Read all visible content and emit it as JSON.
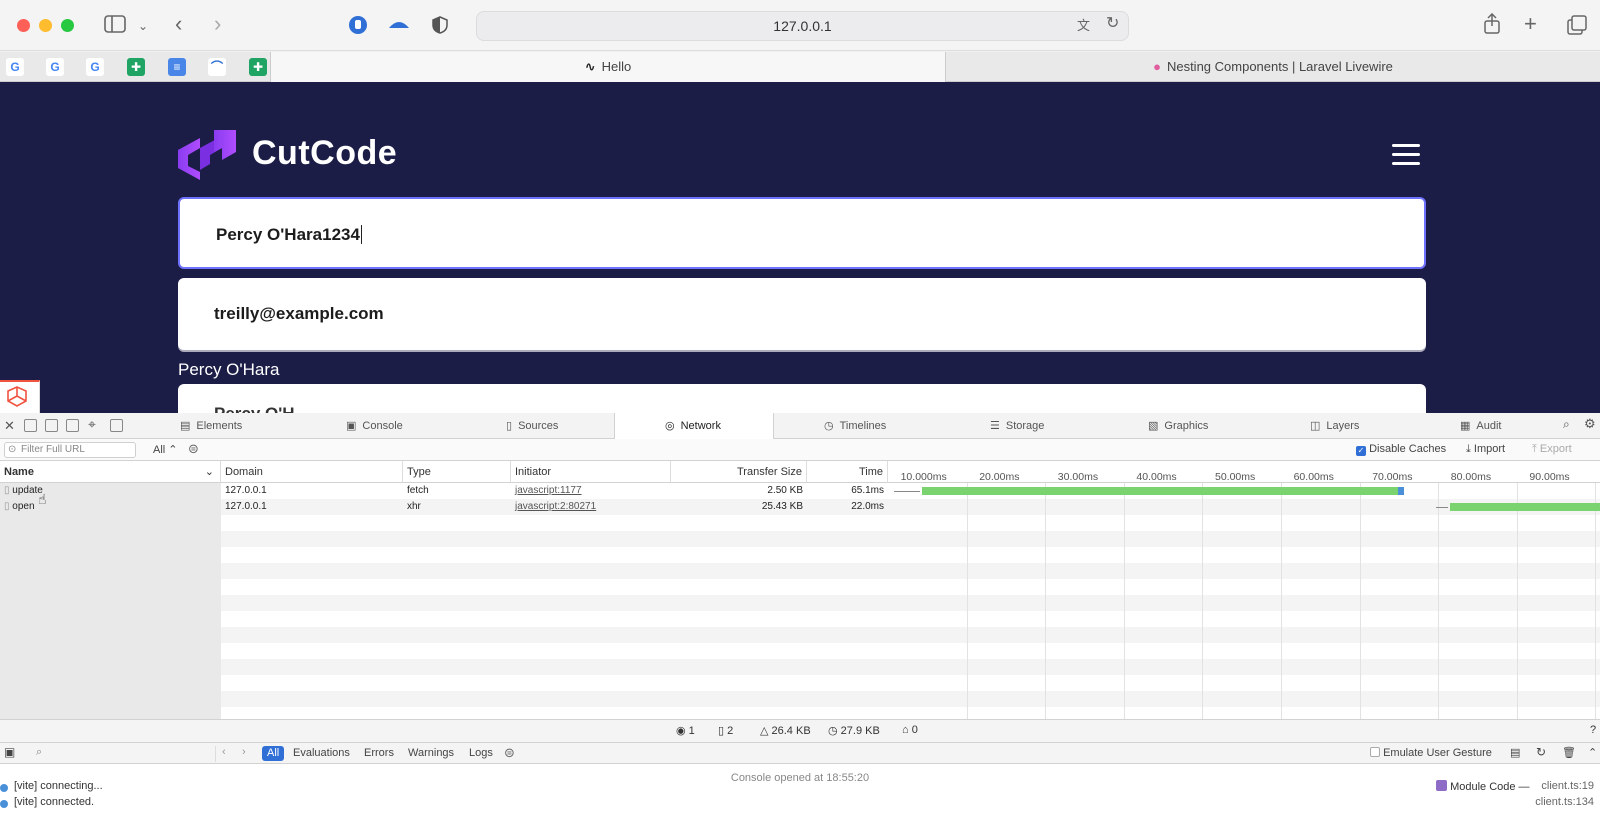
{
  "browser": {
    "url": "127.0.0.1",
    "tabs": [
      {
        "label": "Hello",
        "active": true
      },
      {
        "label": "Nesting Components | Laravel Livewire",
        "active": false
      }
    ],
    "bookmark_icons": [
      "google-icon",
      "google-icon",
      "google-icon",
      "sheets-icon",
      "docs-icon",
      "app-icon",
      "sheets-icon"
    ]
  },
  "page": {
    "brand": "CutCode",
    "name_input_value": "Percy O'Hara1234",
    "email_input_value": "treilly@example.com",
    "name_label": "Percy O'Hara",
    "third_field_value": "Percy O'H"
  },
  "devtools": {
    "tabs": [
      "Elements",
      "Console",
      "Sources",
      "Network",
      "Timelines",
      "Storage",
      "Graphics",
      "Layers",
      "Audit"
    ],
    "active_tab": "Network",
    "filter_placeholder": "Filter Full URL",
    "type_filter": "All",
    "disable_caches_label": "Disable Caches",
    "import_label": "Import",
    "export_label": "Export",
    "columns": [
      "Name",
      "Domain",
      "Type",
      "Initiator",
      "Transfer Size",
      "Time"
    ],
    "waterfall_ticks": [
      "10.000ms",
      "20.00ms",
      "30.00ms",
      "40.00ms",
      "50.00ms",
      "60.00ms",
      "70.00ms",
      "80.00ms",
      "90.00ms"
    ],
    "rows": [
      {
        "name": "update",
        "domain": "127.0.0.1",
        "type": "fetch",
        "initiator": "javascript:1177",
        "size": "2.50 KB",
        "time": "65.1ms"
      },
      {
        "name": "open",
        "domain": "127.0.0.1",
        "type": "xhr",
        "initiator": "javascript:2:80271",
        "size": "25.43 KB",
        "time": "22.0ms"
      }
    ],
    "status": {
      "requests": "1",
      "resources": "2",
      "transferred": "26.4 KB",
      "size": "27.9 KB",
      "errors": "0"
    },
    "console_filters": [
      "All",
      "Evaluations",
      "Errors",
      "Warnings",
      "Logs"
    ],
    "emulate_label": "Emulate User Gesture",
    "console_opened": "Console opened at 18:55:20",
    "logs": [
      {
        "text": "[vite] connecting...",
        "source": "client.ts:19"
      },
      {
        "text": "[vite] connected.",
        "source": "client.ts:134"
      }
    ],
    "module_code_label": "Module Code",
    "colors": {
      "waterfall_bar": "#7ad36e",
      "accent": "#2f6fd6"
    }
  }
}
